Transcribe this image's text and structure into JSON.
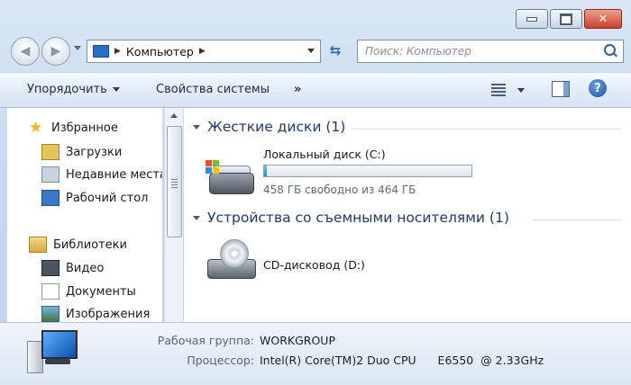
{
  "window": {
    "caption_buttons": {
      "minimize_icon": "minimize-icon",
      "maximize_icon": "maximize-icon",
      "close_icon": "close-icon"
    }
  },
  "navigation": {
    "address_path": "Компьютер",
    "search_placeholder": "Поиск: Компьютер"
  },
  "toolbar": {
    "organize_label": "Упорядочить",
    "system_properties_label": "Свойства системы",
    "more_label": "»"
  },
  "sidebar": {
    "favorites": {
      "label": "Избранное",
      "items": [
        {
          "label": "Загрузки"
        },
        {
          "label": "Недавние места"
        },
        {
          "label": "Рабочий стол"
        }
      ]
    },
    "libraries": {
      "label": "Библиотеки",
      "items": [
        {
          "label": "Видео"
        },
        {
          "label": "Документы"
        },
        {
          "label": "Изображения"
        }
      ]
    }
  },
  "content": {
    "groups": [
      {
        "title": "Жесткие диски (1)",
        "drives": [
          {
            "name": "Локальный диск (C:)",
            "free_text": "458 ГБ свободно из 464 ГБ",
            "used_fraction": 0.013
          }
        ]
      },
      {
        "title": "Устройства со съемными носителями (1)",
        "drives": [
          {
            "name": "CD-дисковод (D:)"
          }
        ]
      }
    ]
  },
  "details": {
    "workgroup_label": "Рабочая группа:",
    "workgroup_value": "WORKGROUP",
    "processor_label": "Процессор:",
    "processor_value": "Intel(R) Core(TM)2 Duo CPU      E6550  @ 2.33GHz"
  },
  "colors": {
    "accent": "#1e3a6e",
    "capacity_bar": "#1d8fd0",
    "close_button": "#c8402c"
  }
}
